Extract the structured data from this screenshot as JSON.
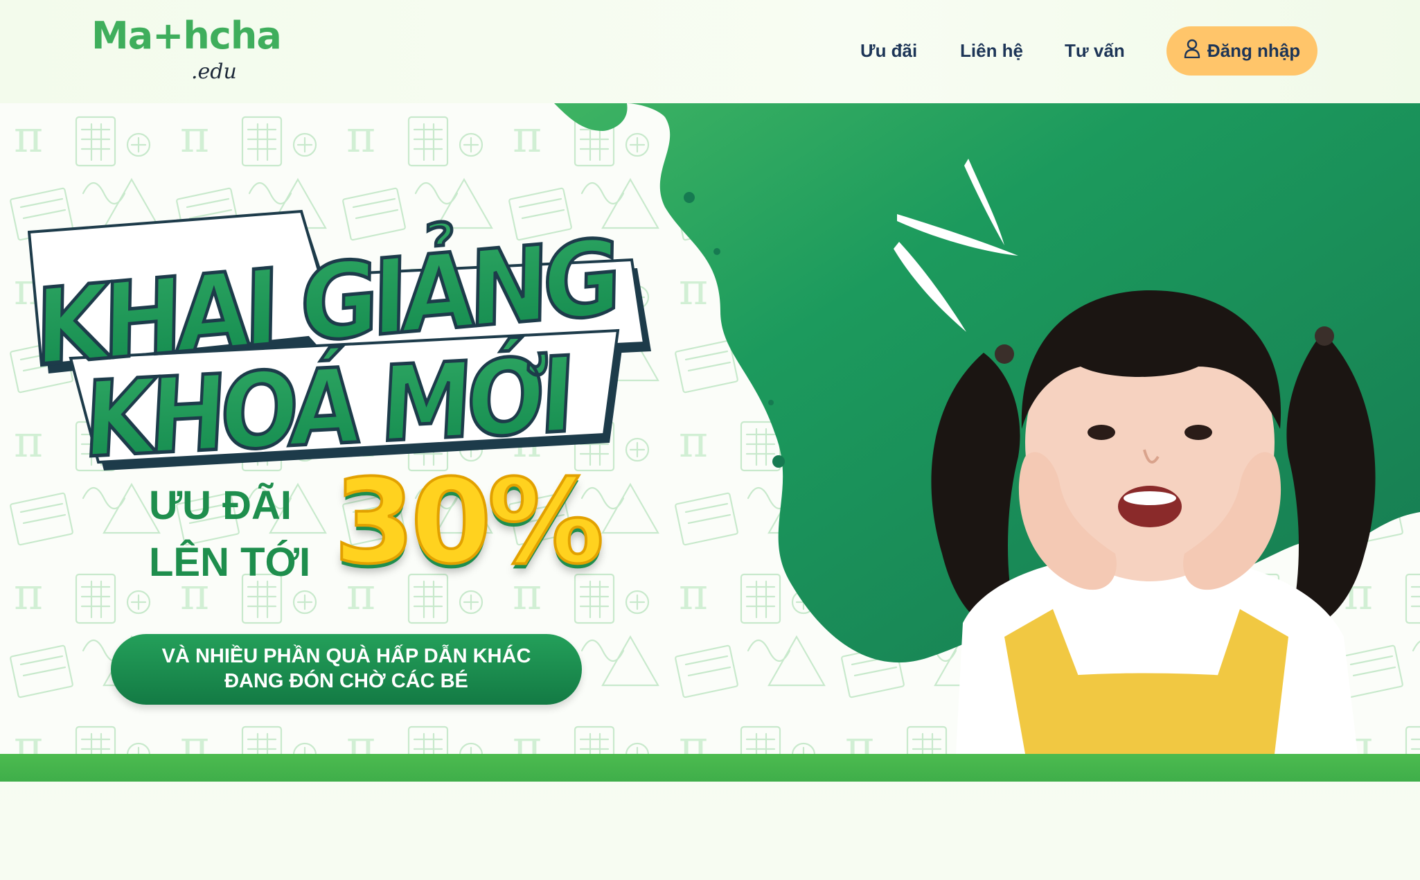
{
  "brand": {
    "logo_text": "Ma+hcha",
    "logo_sub": ".edu"
  },
  "nav": {
    "links": [
      "Ưu đãi",
      "Liên hệ",
      "Tư vấn"
    ],
    "login_label": "Đăng nhập"
  },
  "banner": {
    "headline_line1": "KHAI GIẢNG",
    "headline_line2": "KHOÁ MỚI",
    "offer_line1": "ƯU ĐÃI",
    "offer_line2": "LÊN TỚI",
    "offer_value": "30%",
    "gift_line1": "VÀ NHIỀU PHẦN QUÀ HẤP DẪN KHÁC",
    "gift_line2": "ĐANG ĐÓN CHỜ CÁC BÉ"
  },
  "colors": {
    "brand_green": "#3fae5c",
    "dark_green": "#1a8a56",
    "accent_yellow": "#ffc56a",
    "nav_text": "#1d3557"
  },
  "icons": {
    "login": "user-icon"
  }
}
